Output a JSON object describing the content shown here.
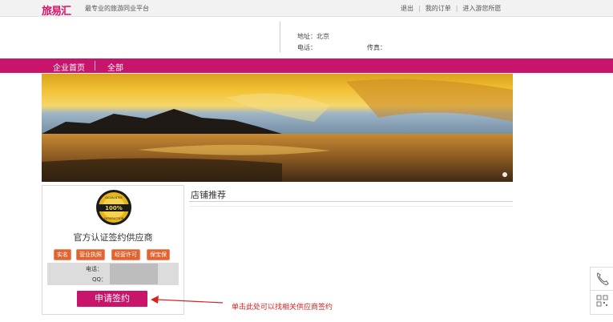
{
  "topbar": {
    "logo": "旅易汇",
    "slogan": "最专业的旅游同业平台",
    "links": [
      "退出",
      "我的订单",
      "进入游您所愿"
    ]
  },
  "header": {
    "address": "地址：北京",
    "phone": "电话：",
    "fax": "传真："
  },
  "nav": {
    "items": [
      "企业首页",
      "全部"
    ]
  },
  "badge": {
    "top": "GUARANTEE",
    "center": "100%",
    "bottom": "SATISFACTION"
  },
  "supplier": {
    "cert_title": "官方认证签约供应商",
    "tags": [
      "实名",
      "营业执照",
      "经营许可",
      "保宝保"
    ],
    "contact_phone": "电话：",
    "contact_qq": "QQ：",
    "apply_button": "申请签约"
  },
  "section": {
    "title": "店铺推荐"
  },
  "annotation": {
    "text": "单击此处可以找相关供应商签约",
    "color": "#d9231f"
  },
  "colors": {
    "brand": "#c8146b",
    "tag": "#e2632f"
  },
  "floating": {
    "icons": [
      "phone-icon",
      "qrcode-icon"
    ]
  }
}
